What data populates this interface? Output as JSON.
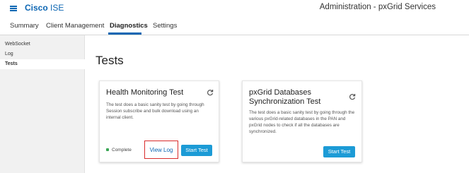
{
  "header": {
    "brand_cisco": "Cisco",
    "brand_product": "ISE",
    "title": "Administration - pxGrid Services"
  },
  "tabs": [
    {
      "label": "Summary"
    },
    {
      "label": "Client Management"
    },
    {
      "label": "Diagnostics",
      "active": true
    },
    {
      "label": "Settings"
    }
  ],
  "sidebar": {
    "items": [
      {
        "label": "WebSocket"
      },
      {
        "label": "Log"
      },
      {
        "label": "Tests",
        "active": true
      }
    ]
  },
  "main": {
    "title": "Tests",
    "cards": [
      {
        "title": "Health Monitoring Test",
        "description_lines": [
          "The test does a basic sanity test by going through",
          "Session subscribe and bulk download using an",
          "internal client."
        ],
        "status": "Complete",
        "view_log_label": "View Log",
        "start_label": "Start Test"
      },
      {
        "title_lines": [
          "pxGrid Databases",
          "Synchronization Test"
        ],
        "description_lines": [
          "The test does a basic sanity test by going through the",
          "various pxGrid-related databases in the PAN and",
          "pxGrid nodes to check if all the databases are",
          "synchronized."
        ],
        "start_label": "Start Test"
      }
    ]
  },
  "colors": {
    "accent": "#0c66b3",
    "button": "#1c9bd6",
    "status_ok": "#3aa655",
    "highlight": "#d92c2c"
  },
  "icons": [
    "hamburger-menu-icon",
    "refresh-icon",
    "status-dot-icon"
  ]
}
